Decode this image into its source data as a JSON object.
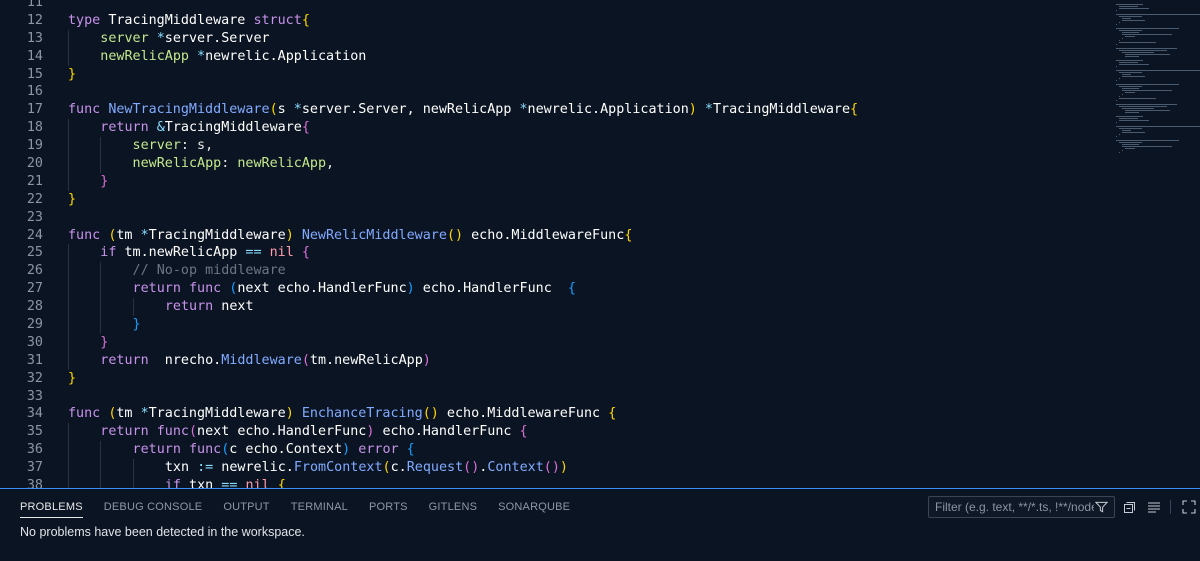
{
  "editor": {
    "lines": [
      {
        "n": "11",
        "indent": 0,
        "tokens": []
      },
      {
        "n": "12",
        "indent": 0,
        "tokens": [
          [
            "kw",
            "type "
          ],
          [
            "ty",
            "TracingMiddleware "
          ],
          [
            "kw",
            "struct"
          ],
          [
            "bk1",
            "{"
          ]
        ]
      },
      {
        "n": "13",
        "indent": 1,
        "tokens": [
          [
            "fd",
            "server "
          ],
          [
            "op",
            "*"
          ],
          [
            "ty",
            "server.Server"
          ]
        ]
      },
      {
        "n": "14",
        "indent": 1,
        "tokens": [
          [
            "fd",
            "newRelicApp "
          ],
          [
            "op",
            "*"
          ],
          [
            "ty",
            "newrelic.Application"
          ]
        ]
      },
      {
        "n": "15",
        "indent": 0,
        "tokens": [
          [
            "bk1",
            "}"
          ]
        ]
      },
      {
        "n": "16",
        "indent": 0,
        "tokens": []
      },
      {
        "n": "17",
        "indent": 0,
        "tokens": [
          [
            "kw",
            "func "
          ],
          [
            "fn",
            "NewTracingMiddleware"
          ],
          [
            "bk1",
            "("
          ],
          [
            "ty",
            "s "
          ],
          [
            "op",
            "*"
          ],
          [
            "ty",
            "server.Server, newRelicApp "
          ],
          [
            "op",
            "*"
          ],
          [
            "ty",
            "newrelic.Application"
          ],
          [
            "bk1",
            ")"
          ],
          [
            "ty",
            " "
          ],
          [
            "op",
            "*"
          ],
          [
            "ty",
            "TracingMiddleware"
          ],
          [
            "bk1",
            "{"
          ]
        ]
      },
      {
        "n": "18",
        "indent": 1,
        "tokens": [
          [
            "kw",
            "return "
          ],
          [
            "op",
            "&"
          ],
          [
            "ty",
            "TracingMiddleware"
          ],
          [
            "bk2",
            "{"
          ]
        ]
      },
      {
        "n": "19",
        "indent": 2,
        "tokens": [
          [
            "fd",
            "server"
          ],
          [
            "pl",
            ": s,"
          ]
        ]
      },
      {
        "n": "20",
        "indent": 2,
        "tokens": [
          [
            "fd",
            "newRelicApp"
          ],
          [
            "pl",
            ": "
          ],
          [
            "fd",
            "newRelicApp"
          ],
          [
            "pl",
            ","
          ]
        ]
      },
      {
        "n": "21",
        "indent": 1,
        "tokens": [
          [
            "bk2",
            "}"
          ]
        ]
      },
      {
        "n": "22",
        "indent": 0,
        "tokens": [
          [
            "bk1",
            "}"
          ]
        ]
      },
      {
        "n": "23",
        "indent": 0,
        "tokens": []
      },
      {
        "n": "24",
        "indent": 0,
        "tokens": [
          [
            "kw",
            "func "
          ],
          [
            "bk1",
            "("
          ],
          [
            "ty",
            "tm "
          ],
          [
            "op",
            "*"
          ],
          [
            "ty",
            "TracingMiddleware"
          ],
          [
            "bk1",
            ")"
          ],
          [
            "ty",
            " "
          ],
          [
            "fn",
            "NewRelicMiddleware"
          ],
          [
            "bk1",
            "()"
          ],
          [
            "ty",
            " echo.MiddlewareFunc"
          ],
          [
            "bk1",
            "{"
          ]
        ]
      },
      {
        "n": "25",
        "indent": 1,
        "tokens": [
          [
            "kw",
            "if "
          ],
          [
            "ty",
            "tm.newRelicApp "
          ],
          [
            "op",
            "== "
          ],
          [
            "nl",
            "nil "
          ],
          [
            "bk2",
            "{"
          ]
        ]
      },
      {
        "n": "26",
        "indent": 2,
        "tokens": [
          [
            "cm",
            "// No-op middleware"
          ]
        ]
      },
      {
        "n": "27",
        "indent": 2,
        "tokens": [
          [
            "kw",
            "return func "
          ],
          [
            "bk3",
            "("
          ],
          [
            "ty",
            "next echo.HandlerFunc"
          ],
          [
            "bk3",
            ")"
          ],
          [
            "ty",
            " echo.HandlerFunc  "
          ],
          [
            "bk3",
            "{"
          ]
        ]
      },
      {
        "n": "28",
        "indent": 3,
        "tokens": [
          [
            "kw",
            "return "
          ],
          [
            "ty",
            "next"
          ]
        ]
      },
      {
        "n": "29",
        "indent": 2,
        "tokens": [
          [
            "bk3",
            "}"
          ]
        ]
      },
      {
        "n": "30",
        "indent": 1,
        "tokens": [
          [
            "bk2",
            "}"
          ]
        ]
      },
      {
        "n": "31",
        "indent": 1,
        "tokens": [
          [
            "kw",
            "return  "
          ],
          [
            "ty",
            "nrecho."
          ],
          [
            "fn",
            "Middleware"
          ],
          [
            "bk2",
            "("
          ],
          [
            "ty",
            "tm.newRelicApp"
          ],
          [
            "bk2",
            ")"
          ]
        ]
      },
      {
        "n": "32",
        "indent": 0,
        "tokens": [
          [
            "bk1",
            "}"
          ]
        ]
      },
      {
        "n": "33",
        "indent": 0,
        "tokens": []
      },
      {
        "n": "34",
        "indent": 0,
        "tokens": [
          [
            "kw",
            "func "
          ],
          [
            "bk1",
            "("
          ],
          [
            "ty",
            "tm "
          ],
          [
            "op",
            "*"
          ],
          [
            "ty",
            "TracingMiddleware"
          ],
          [
            "bk1",
            ")"
          ],
          [
            "ty",
            " "
          ],
          [
            "fn",
            "EnchanceTracing"
          ],
          [
            "bk1",
            "()"
          ],
          [
            "ty",
            " echo.MiddlewareFunc "
          ],
          [
            "bk1",
            "{"
          ]
        ]
      },
      {
        "n": "35",
        "indent": 1,
        "tokens": [
          [
            "kw",
            "return func"
          ],
          [
            "bk2",
            "("
          ],
          [
            "ty",
            "next echo.HandlerFunc"
          ],
          [
            "bk2",
            ")"
          ],
          [
            "ty",
            " echo.HandlerFunc "
          ],
          [
            "bk2",
            "{"
          ]
        ]
      },
      {
        "n": "36",
        "indent": 2,
        "tokens": [
          [
            "kw",
            "return func"
          ],
          [
            "bk3",
            "("
          ],
          [
            "ty",
            "c echo.Context"
          ],
          [
            "bk3",
            ")"
          ],
          [
            "ty",
            " "
          ],
          [
            "kw",
            "error "
          ],
          [
            "bk3",
            "{"
          ]
        ]
      },
      {
        "n": "37",
        "indent": 3,
        "tokens": [
          [
            "ty",
            "txn "
          ],
          [
            "op",
            ":= "
          ],
          [
            "ty",
            "newrelic."
          ],
          [
            "fn",
            "FromContext"
          ],
          [
            "bk1",
            "("
          ],
          [
            "ty",
            "c."
          ],
          [
            "fn",
            "Request"
          ],
          [
            "bk2",
            "()"
          ],
          [
            "ty",
            "."
          ],
          [
            "fn",
            "Context"
          ],
          [
            "bk2",
            "()"
          ],
          [
            "bk1",
            ")"
          ]
        ]
      },
      {
        "n": "38",
        "indent": 3,
        "tokens": [
          [
            "kw",
            "if "
          ],
          [
            "ty",
            "txn "
          ],
          [
            "op",
            "== "
          ],
          [
            "nl",
            "nil "
          ],
          [
            "bk1",
            "{"
          ]
        ]
      }
    ]
  },
  "panel": {
    "tabs": [
      "PROBLEMS",
      "DEBUG CONSOLE",
      "OUTPUT",
      "TERMINAL",
      "PORTS",
      "GITLENS",
      "SONARQUBE"
    ],
    "active_tab": "PROBLEMS",
    "filter_placeholder": "Filter (e.g. text, **/*.ts, !**/node_modules/**)",
    "message": "No problems have been detected in the workspace.",
    "icons": [
      "filter-icon",
      "collapse-all-icon",
      "view-as-list-icon",
      "maximize-panel-icon"
    ]
  },
  "colors": {
    "background": "#0b1422",
    "accent": "#3a8ff5",
    "keyword": "#c792ea",
    "function": "#82aaff",
    "field": "#c3e88d"
  }
}
